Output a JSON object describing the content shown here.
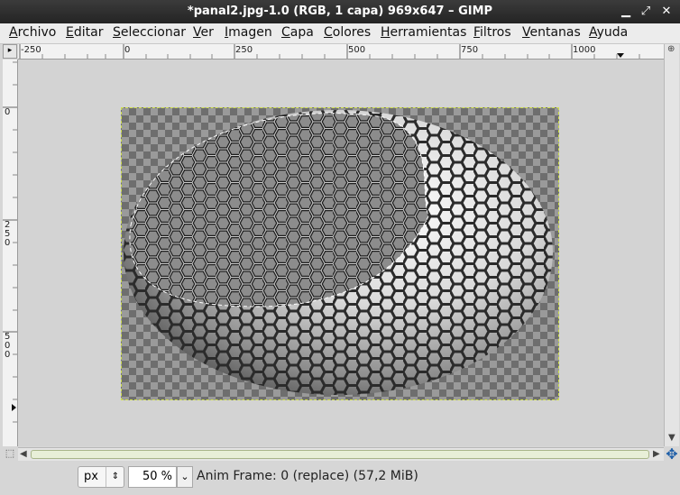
{
  "window": {
    "title": "*panal2.jpg-1.0 (RGB, 1 capa) 969x647 – GIMP"
  },
  "menu": [
    "Archivo",
    "Editar",
    "Seleccionar",
    "Ver",
    "Imagen",
    "Capa",
    "Colores",
    "Herramientas",
    "Filtros",
    "Ventanas",
    "Ayuda"
  ],
  "ruler_h": [
    "-250",
    "0",
    "250",
    "500",
    "750",
    "1000"
  ],
  "ruler_v": [
    "0",
    "250",
    "500"
  ],
  "status": {
    "unit": "px",
    "zoom": "50 %",
    "message": "Anim Frame: 0 (replace) (57,2 MiB)"
  },
  "icons": {
    "minimize": "minimize-icon",
    "restore": "restore-icon",
    "close": "close-icon",
    "navigate": "navigate-icon",
    "quickmask": "quick-mask-icon"
  },
  "colors": {
    "selection_border": "#cfe04a",
    "accent": "#1d5ea8"
  }
}
